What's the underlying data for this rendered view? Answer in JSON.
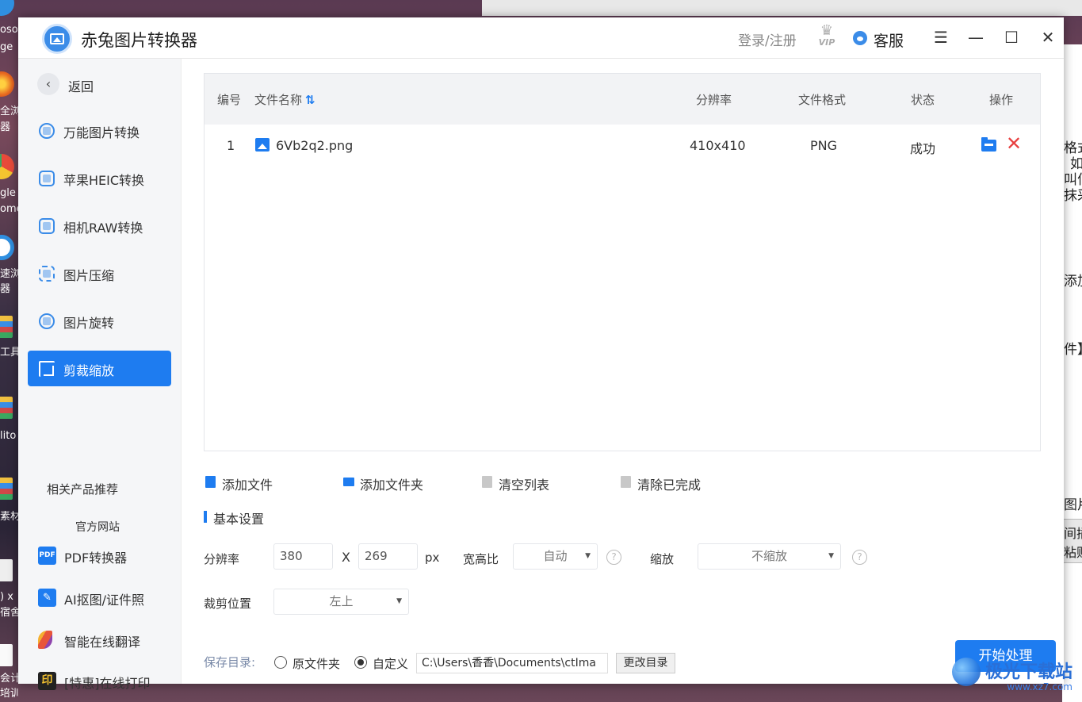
{
  "desktop": {
    "icons": [
      {
        "label": "oso",
        "sub": "ge"
      },
      {
        "label": "全浏",
        "sub": "器"
      },
      {
        "label": "gle",
        "sub": "ome"
      },
      {
        "label": "速浏",
        "sub": "器"
      },
      {
        "label": "工具",
        "sub": ""
      },
      {
        "label": "lito",
        "sub": ""
      },
      {
        "label": "素材",
        "sub": ""
      },
      {
        "label": ") x",
        "sub": "宿舍"
      },
      {
        "label": "会计",
        "sub": "培训"
      }
    ],
    "bg_doc_lines": [
      "格式",
      "如",
      "叫何",
      "抹采",
      "添加",
      "件】",
      "图片",
      "间插",
      "粘贴"
    ],
    "watermark": {
      "main": "极光下载站",
      "sub": "www.xz7.com"
    }
  },
  "app": {
    "title": "赤兔图片转换器",
    "login": "登录/注册",
    "vip_text": "VIP",
    "service": "客服",
    "window_buttons": {
      "menu": "☰",
      "minimize": "—",
      "maximize": "☐",
      "close": "✕"
    }
  },
  "sidebar": {
    "back": "返回",
    "items": [
      {
        "label": "万能图片转换",
        "active": false
      },
      {
        "label": "苹果HEIC转换",
        "active": false
      },
      {
        "label": "相机RAW转换",
        "active": false
      },
      {
        "label": "图片压缩",
        "active": false
      },
      {
        "label": "图片旋转",
        "active": false
      },
      {
        "label": "剪裁缩放",
        "active": true
      }
    ],
    "recommend_title": "相关产品推荐",
    "official_site": "官方网站",
    "products": [
      {
        "label": "PDF转换器",
        "icon_text": "PDF",
        "color": "#1e7cf0"
      },
      {
        "label": "AI抠图/证件照",
        "icon_text": "✎",
        "color": "#1e7cf0"
      },
      {
        "label": "智能在线翻译",
        "icon_text": "",
        "color": "#e8553a"
      },
      {
        "label": "[特惠]在线打印",
        "icon_text": "印",
        "color": "#222"
      }
    ]
  },
  "table": {
    "headers": {
      "num": "编号",
      "name": "文件名称",
      "sort_icon": "⇅",
      "resolution": "分辨率",
      "format": "文件格式",
      "status": "状态",
      "action": "操作"
    },
    "rows": [
      {
        "num": "1",
        "name": "6Vb2q2.png",
        "resolution": "410x410",
        "format": "PNG",
        "status": "成功"
      }
    ]
  },
  "actions": {
    "add_file": "添加文件",
    "add_folder": "添加文件夹",
    "clear_list": "清空列表",
    "clear_done": "清除已完成"
  },
  "settings": {
    "title": "基本设置",
    "resolution_label": "分辨率",
    "width": "380",
    "x_sep": "X",
    "height": "269",
    "unit": "px",
    "ratio_label": "宽高比",
    "ratio_value": "自动",
    "scale_label": "缩放",
    "scale_value": "不缩放",
    "crop_label": "裁剪位置",
    "crop_value": "左上",
    "help": "?"
  },
  "save": {
    "label": "保存目录:",
    "option_original": "原文件夹",
    "option_custom": "自定义",
    "selected": "custom",
    "path": "C:\\Users\\香香\\Documents\\ctIma",
    "change_button": "更改目录",
    "start_button": "开始处理"
  },
  "colors": {
    "accent": "#1e7cf0",
    "delete": "#e84040"
  }
}
